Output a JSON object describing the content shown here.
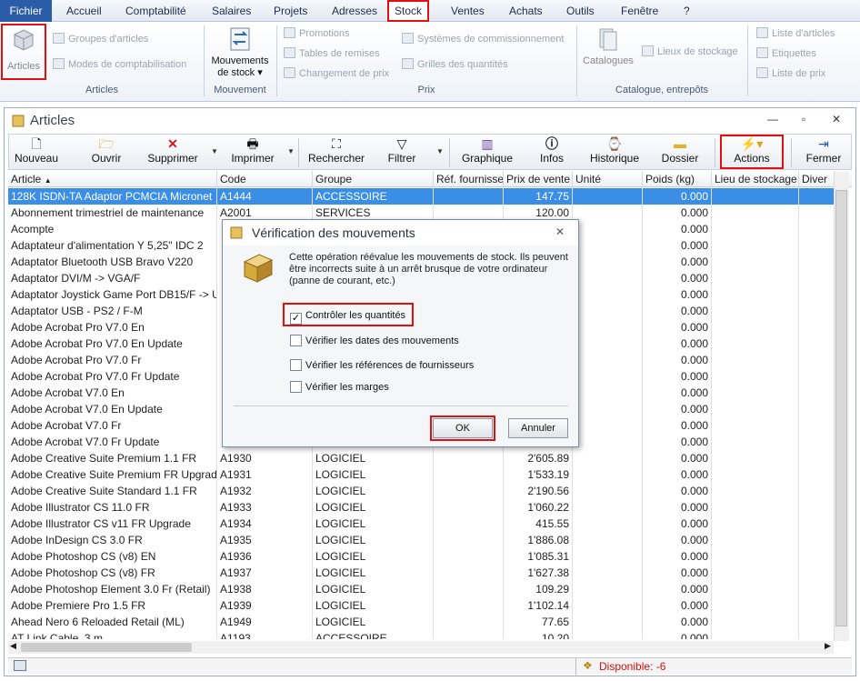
{
  "menu": [
    "Fichier",
    "Accueil",
    "Comptabilité",
    "Salaires",
    "Projets",
    "Adresses",
    "Stock",
    "Ventes",
    "Achats",
    "Outils",
    "Fenêtre",
    "?"
  ],
  "ribbon": {
    "articles": "Articles",
    "groupes": "Groupes d'articles",
    "modes": "Modes de comptabilisation",
    "group_articles": "Articles",
    "mouvements": "Mouvements",
    "de_stock": "de stock",
    "group_mouvement": "Mouvement",
    "promotions": "Promotions",
    "tables_remises": "Tables de remises",
    "changement_prix": "Changement de prix",
    "systemes": "Systèmes de commissionnement",
    "grilles": "Grilles des quantités",
    "group_prix": "Prix",
    "catalogues": "Catalogues",
    "lieux": "Lieux de stockage",
    "group_catalogue": "Catalogue, entrepôts",
    "liste_articles": "Liste d'articles",
    "etiquettes": "Etiquettes",
    "liste_prix": "Liste de prix"
  },
  "window": {
    "title": "Articles"
  },
  "toolbar": {
    "nouveau": "Nouveau",
    "ouvrir": "Ouvrir",
    "supprimer": "Supprimer",
    "imprimer": "Imprimer",
    "rechercher": "Rechercher",
    "filtrer": "Filtrer",
    "graphique": "Graphique",
    "infos": "Infos",
    "historique": "Historique",
    "dossier": "Dossier",
    "actions": "Actions",
    "fermer": "Fermer"
  },
  "columns": [
    "Article",
    "Code",
    "Groupe",
    "Réf. fournisseur",
    "Prix de vente",
    "Unité",
    "Poids (kg)",
    "Lieu de stockage",
    "Diver"
  ],
  "rows": [
    [
      "128K ISDN-TA Adaptor PCMCIA Micronet",
      "A1444",
      "ACCESSOIRE",
      "",
      "147.75",
      "",
      "0.000"
    ],
    [
      "Abonnement trimestriel de maintenance",
      "A2001",
      "SERVICES",
      "",
      "120.00",
      "",
      "0.000"
    ],
    [
      "Acompte",
      "",
      "",
      "",
      "",
      "",
      "0.000"
    ],
    [
      "Adaptateur d'alimentation Y 5,25\" IDC 2",
      "",
      "",
      "",
      "",
      "",
      "0.000"
    ],
    [
      "Adaptator Bluetooth USB Bravo V220",
      "",
      "",
      "",
      "",
      "",
      "0.000"
    ],
    [
      "Adaptator DVI/M -> VGA/F",
      "",
      "",
      "",
      "",
      "",
      "0.000"
    ],
    [
      "Adaptator Joystick Game Port DB15/F -> U",
      "",
      "",
      "",
      "",
      "",
      "0.000"
    ],
    [
      "Adaptator USB - PS2 / F-M",
      "",
      "",
      "",
      "",
      "",
      "0.000"
    ],
    [
      "Adobe Acrobat Pro V7.0 En",
      "",
      "",
      "",
      "",
      "",
      "0.000"
    ],
    [
      "Adobe Acrobat Pro V7.0 En Update",
      "",
      "",
      "",
      "",
      "",
      "0.000"
    ],
    [
      "Adobe Acrobat Pro V7.0 Fr",
      "",
      "",
      "",
      "",
      "",
      "0.000"
    ],
    [
      "Adobe Acrobat Pro V7.0 Fr Update",
      "",
      "",
      "",
      "",
      "",
      "0.000"
    ],
    [
      "Adobe Acrobat V7.0 En",
      "",
      "",
      "",
      "",
      "",
      "0.000"
    ],
    [
      "Adobe Acrobat V7.0 En Update",
      "",
      "",
      "",
      "",
      "",
      "0.000"
    ],
    [
      "Adobe Acrobat V7.0 Fr",
      "",
      "",
      "",
      "",
      "",
      "0.000"
    ],
    [
      "Adobe Acrobat V7.0 Fr Update",
      "",
      "",
      "",
      "",
      "",
      "0.000"
    ],
    [
      "Adobe Creative Suite Premium 1.1 FR",
      "A1930",
      "LOGICIEL",
      "",
      "2'605.89",
      "",
      "0.000"
    ],
    [
      "Adobe Creative Suite Premium FR Upgrade",
      "A1931",
      "LOGICIEL",
      "",
      "1'533.19",
      "",
      "0.000"
    ],
    [
      "Adobe Creative Suite Standard 1.1 FR",
      "A1932",
      "LOGICIEL",
      "",
      "2'190.56",
      "",
      "0.000"
    ],
    [
      "Adobe Illustrator CS 11.0 FR",
      "A1933",
      "LOGICIEL",
      "",
      "1'060.22",
      "",
      "0.000"
    ],
    [
      "Adobe Illustrator CS v11 FR Upgrade",
      "A1934",
      "LOGICIEL",
      "",
      "415.55",
      "",
      "0.000"
    ],
    [
      "Adobe InDesign CS 3.0 FR",
      "A1935",
      "LOGICIEL",
      "",
      "1'886.08",
      "",
      "0.000"
    ],
    [
      "Adobe Photoshop CS (v8) EN",
      "A1936",
      "LOGICIEL",
      "",
      "1'085.31",
      "",
      "0.000"
    ],
    [
      "Adobe Photoshop CS (v8) FR",
      "A1937",
      "LOGICIEL",
      "",
      "1'627.38",
      "",
      "0.000"
    ],
    [
      "Adobe Photoshop Element 3.0 Fr (Retail)",
      "A1938",
      "LOGICIEL",
      "",
      "109.29",
      "",
      "0.000"
    ],
    [
      "Adobe Premiere Pro 1.5 FR",
      "A1939",
      "LOGICIEL",
      "",
      "1'102.14",
      "",
      "0.000"
    ],
    [
      "Ahead Nero 6 Reloaded Retail (ML)",
      "A1949",
      "LOGICIEL",
      "",
      "77.65",
      "",
      "0.000"
    ],
    [
      "AT Link Cable, 3 m",
      "A1193",
      "ACCESSOIRE",
      "",
      "10.20",
      "",
      "0.000"
    ]
  ],
  "status": {
    "disponible": "Disponible: -6"
  },
  "dialog": {
    "title": "Vérification des mouvements",
    "text": "Cette opération réévalue les mouvements de stock. Ils peuvent être incorrects suite à un arrêt brusque de votre ordinateur (panne de courant, etc.)",
    "options": [
      {
        "label": "Contrôler les quantités",
        "checked": true
      },
      {
        "label": "Vérifier les dates des mouvements",
        "checked": false
      },
      {
        "label": "Vérifier les références de fournisseurs",
        "checked": false
      },
      {
        "label": "Vérifier les marges",
        "checked": false
      }
    ],
    "ok": "OK",
    "cancel": "Annuler"
  },
  "colors": {
    "accent": "#2a5ca8",
    "selection": "#3a8ee6",
    "highlight": "#e01010",
    "status_text": "#d01010"
  }
}
